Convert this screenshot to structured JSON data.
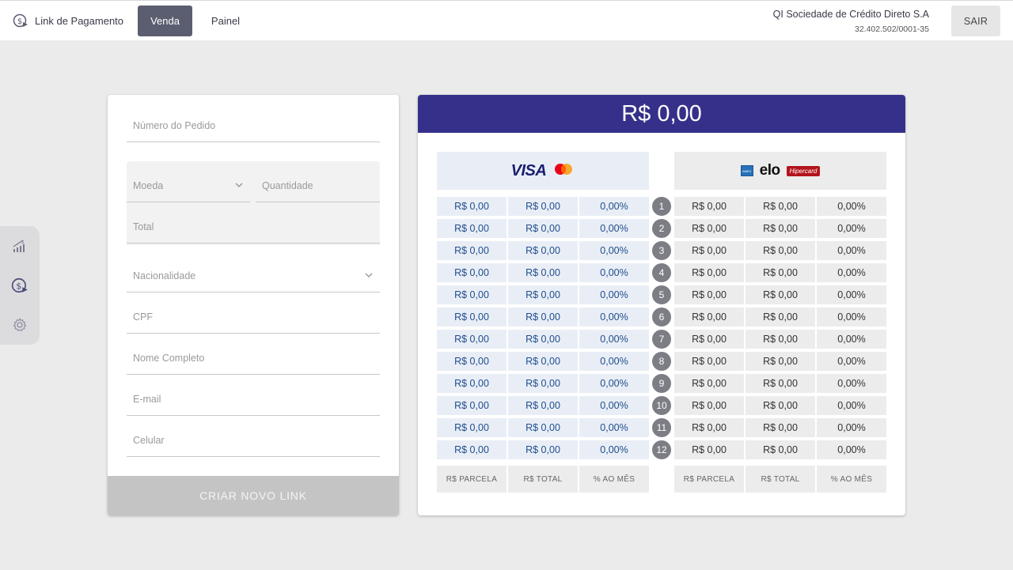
{
  "header": {
    "brand_label": "Link de Pagamento",
    "nav": [
      {
        "label": "Venda",
        "active": true
      },
      {
        "label": "Painel",
        "active": false
      }
    ],
    "company_name": "QI Sociedade de Crédito Direto S.A",
    "company_doc": "32.402.502/0001-35",
    "logout_label": "SAIR"
  },
  "sidebar": {
    "icons": [
      "chart-growth-icon",
      "payment-link-icon",
      "settings-gear-icon"
    ]
  },
  "form": {
    "order_number": {
      "placeholder": "Número do Pedido",
      "value": ""
    },
    "currency": {
      "placeholder": "Moeda",
      "value": ""
    },
    "quantity": {
      "placeholder": "Quantidade",
      "value": ""
    },
    "total": {
      "placeholder": "Total",
      "value": ""
    },
    "nationality": {
      "placeholder": "Nacionalidade",
      "value": ""
    },
    "cpf": {
      "placeholder": "CPF",
      "value": ""
    },
    "full_name": {
      "placeholder": "Nome Completo",
      "value": ""
    },
    "email": {
      "placeholder": "E-mail",
      "value": ""
    },
    "phone": {
      "placeholder": "Celular",
      "value": ""
    },
    "submit_label": "CRIAR NOVO LINK"
  },
  "installments": {
    "amount": "R$ 0,00",
    "left_brands": [
      "VISA",
      "mastercard"
    ],
    "right_brands": [
      "amex",
      "elo",
      "Hipercard"
    ],
    "rows": [
      {
        "n": "1",
        "left": [
          "R$ 0,00",
          "R$ 0,00",
          "0,00%"
        ],
        "right": [
          "R$ 0,00",
          "R$ 0,00",
          "0,00%"
        ]
      },
      {
        "n": "2",
        "left": [
          "R$ 0,00",
          "R$ 0,00",
          "0,00%"
        ],
        "right": [
          "R$ 0,00",
          "R$ 0,00",
          "0,00%"
        ]
      },
      {
        "n": "3",
        "left": [
          "R$ 0,00",
          "R$ 0,00",
          "0,00%"
        ],
        "right": [
          "R$ 0,00",
          "R$ 0,00",
          "0,00%"
        ]
      },
      {
        "n": "4",
        "left": [
          "R$ 0,00",
          "R$ 0,00",
          "0,00%"
        ],
        "right": [
          "R$ 0,00",
          "R$ 0,00",
          "0,00%"
        ]
      },
      {
        "n": "5",
        "left": [
          "R$ 0,00",
          "R$ 0,00",
          "0,00%"
        ],
        "right": [
          "R$ 0,00",
          "R$ 0,00",
          "0,00%"
        ]
      },
      {
        "n": "6",
        "left": [
          "R$ 0,00",
          "R$ 0,00",
          "0,00%"
        ],
        "right": [
          "R$ 0,00",
          "R$ 0,00",
          "0,00%"
        ]
      },
      {
        "n": "7",
        "left": [
          "R$ 0,00",
          "R$ 0,00",
          "0,00%"
        ],
        "right": [
          "R$ 0,00",
          "R$ 0,00",
          "0,00%"
        ]
      },
      {
        "n": "8",
        "left": [
          "R$ 0,00",
          "R$ 0,00",
          "0,00%"
        ],
        "right": [
          "R$ 0,00",
          "R$ 0,00",
          "0,00%"
        ]
      },
      {
        "n": "9",
        "left": [
          "R$ 0,00",
          "R$ 0,00",
          "0,00%"
        ],
        "right": [
          "R$ 0,00",
          "R$ 0,00",
          "0,00%"
        ]
      },
      {
        "n": "10",
        "left": [
          "R$ 0,00",
          "R$ 0,00",
          "0,00%"
        ],
        "right": [
          "R$ 0,00",
          "R$ 0,00",
          "0,00%"
        ]
      },
      {
        "n": "11",
        "left": [
          "R$ 0,00",
          "R$ 0,00",
          "0,00%"
        ],
        "right": [
          "R$ 0,00",
          "R$ 0,00",
          "0,00%"
        ]
      },
      {
        "n": "12",
        "left": [
          "R$ 0,00",
          "R$ 0,00",
          "0,00%"
        ],
        "right": [
          "R$ 0,00",
          "R$ 0,00",
          "0,00%"
        ]
      }
    ],
    "footer_left": [
      "R$ PARCELA",
      "R$ TOTAL",
      "% AO MÊS"
    ],
    "footer_right": [
      "R$ PARCELA",
      "R$ TOTAL",
      "% AO MÊS"
    ]
  },
  "colors": {
    "header_purple": "#35318a",
    "active_tab": "#5b5d70",
    "left_cell_bg": "#e9eef6",
    "left_cell_text": "#1f4d8e",
    "badge": "#7d7d86"
  }
}
